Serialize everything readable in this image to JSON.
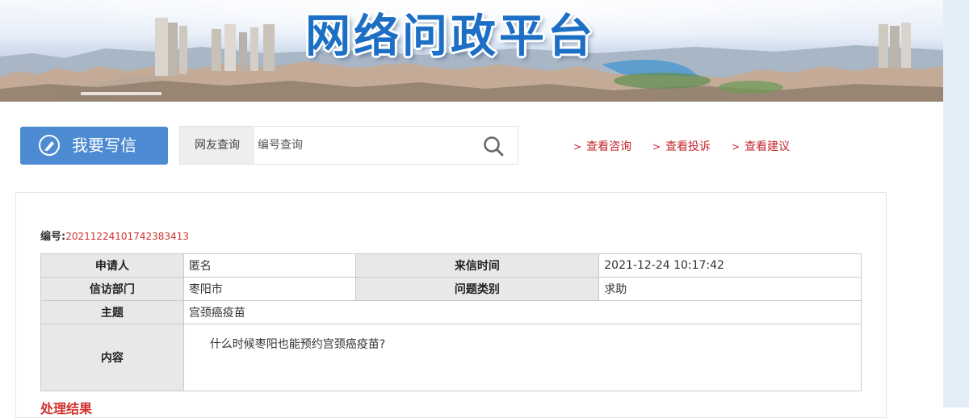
{
  "banner": {
    "title": "网络问政平台"
  },
  "toolbar": {
    "write_label": "我要写信",
    "search_tab": "网友查询",
    "search_placeholder": "编号查询",
    "links": [
      "查看咨询",
      "查看投诉",
      "查看建议"
    ]
  },
  "letter": {
    "code_label": "编号:",
    "code_value": "20211224101742383413",
    "applicant_label": "申请人",
    "applicant_value": "匿名",
    "time_label": "来信时间",
    "time_value": "2021-12-24 10:17:42",
    "dept_label": "信访部门",
    "dept_value": "枣阳市",
    "type_label": "问题类别",
    "type_value": "求助",
    "subject_label": "主题",
    "subject_value": "宫颈癌疫苗",
    "content_label": "内容",
    "content_value": "什么时候枣阳也能预约宫颈癌疫苗?"
  },
  "result": {
    "title": "处理结果"
  },
  "colors": {
    "accent_blue": "#4c8ad1",
    "link_red": "#c4262e",
    "code_red": "#d0312d"
  }
}
